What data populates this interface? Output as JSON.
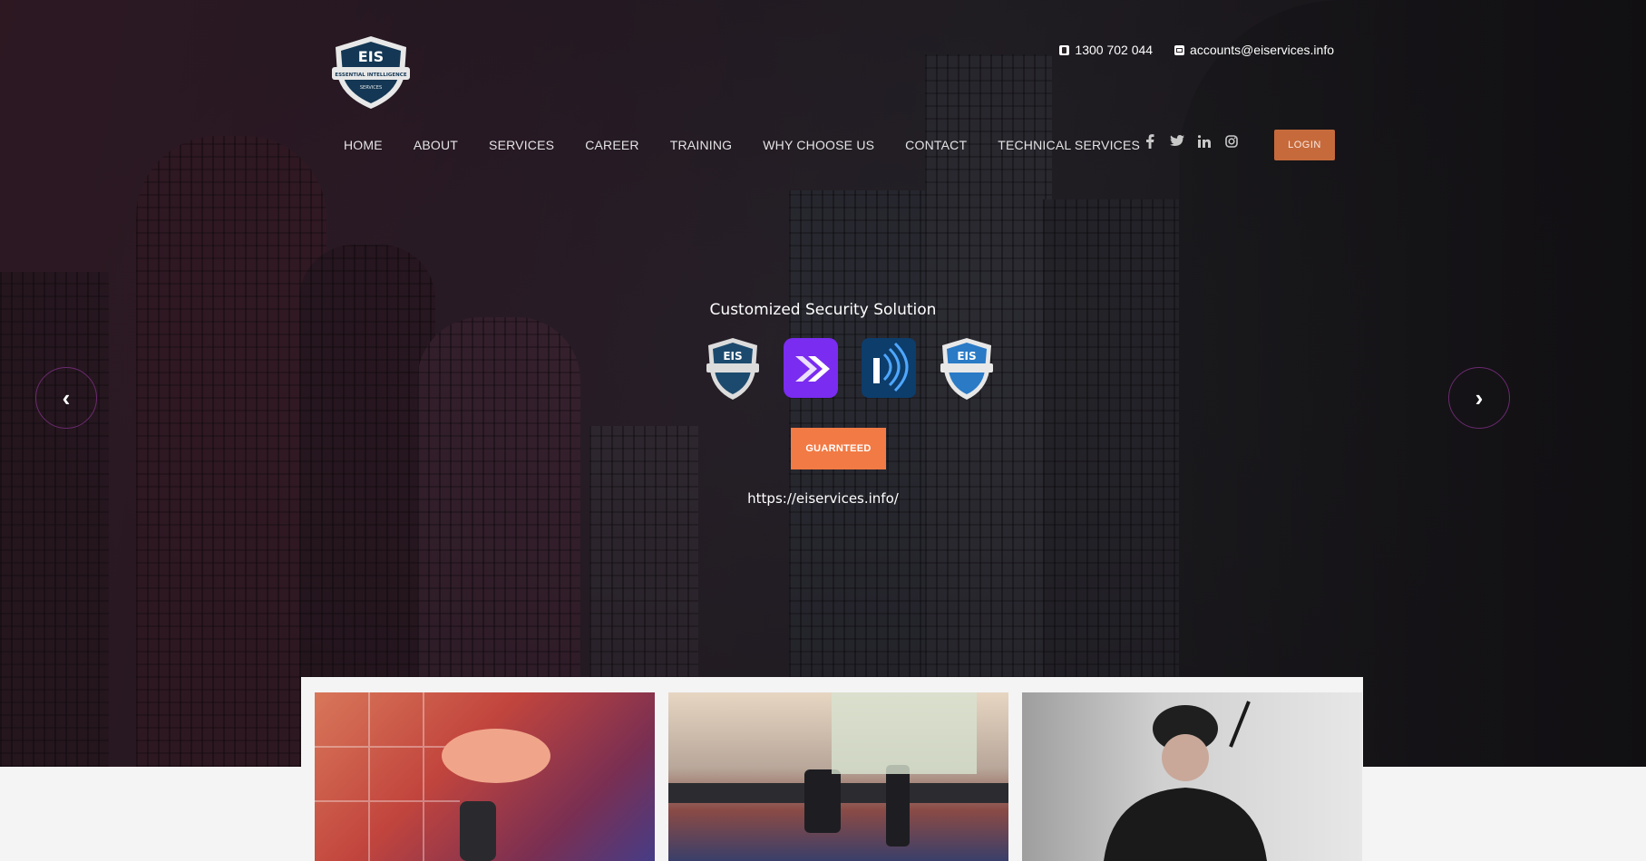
{
  "header": {
    "logo_alt": "EIS Essential Intelligence Services",
    "phone": "1300 702 044",
    "email": "accounts@eiservices.info"
  },
  "nav": {
    "items": [
      "HOME",
      "ABOUT",
      "SERVICES",
      "CAREER",
      "TRAINING",
      "WHY CHOOSE US",
      "CONTACT",
      "TECHNICAL SERVICES"
    ]
  },
  "social": [
    "facebook-icon",
    "twitter-icon",
    "linkedin-icon",
    "instagram-icon"
  ],
  "login_label": "LOGIN",
  "hero": {
    "tagline": "Customized Security Solution",
    "cta_label": "GUARNTEED",
    "url": "https://eiservices.info/",
    "prev_arrow": "‹",
    "next_arrow": "›"
  },
  "partner_logos": [
    {
      "name": "EIS",
      "color": "#1c4a6e"
    },
    {
      "name": "",
      "color": "#7a2cf0"
    },
    {
      "name": "",
      "color": "#0d3d6b"
    },
    {
      "name": "EIS",
      "color": "#2a7ac6"
    }
  ],
  "colors": {
    "login": "#c66a3c",
    "cta": "#f27a44",
    "arrow_border": "#6b2a70"
  },
  "cards": [
    "cctv-image",
    "security-belt-image",
    "security-guard-image"
  ]
}
